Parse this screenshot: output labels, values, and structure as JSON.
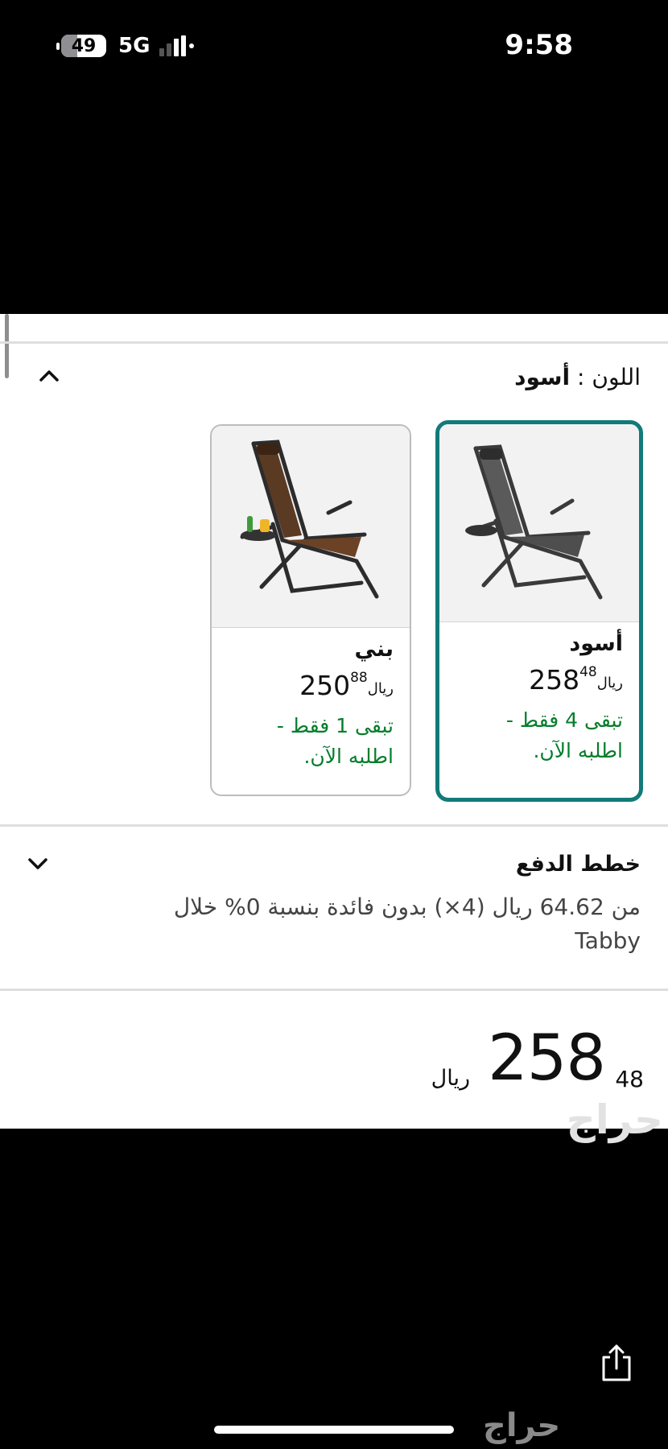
{
  "status_bar": {
    "battery": "49",
    "network": "5G",
    "time": "9:58"
  },
  "color_selector": {
    "label": "اللون :",
    "selected_value": "أسود",
    "options": [
      {
        "name": "أسود",
        "price_whole": "258",
        "price_fraction": "48",
        "currency": "ريال",
        "stock_note": "تبقى 4 فقط - اطلبه الآن.",
        "selected": true
      },
      {
        "name": "بني",
        "price_whole": "250",
        "price_fraction": "88",
        "currency": "ريال",
        "stock_note": "تبقى 1 فقط - اطلبه الآن.",
        "selected": false
      }
    ]
  },
  "payment_plans": {
    "title": "خطط الدفع",
    "description": "من 64.62 ريال (4×) بدون فائدة بنسبة 0% خلال Tabby"
  },
  "total_price": {
    "whole": "258",
    "fraction": "48",
    "currency": "ريال"
  },
  "watermark": "حراج",
  "colors": {
    "accent": "#127a7a",
    "stock_green": "#067d2c"
  }
}
